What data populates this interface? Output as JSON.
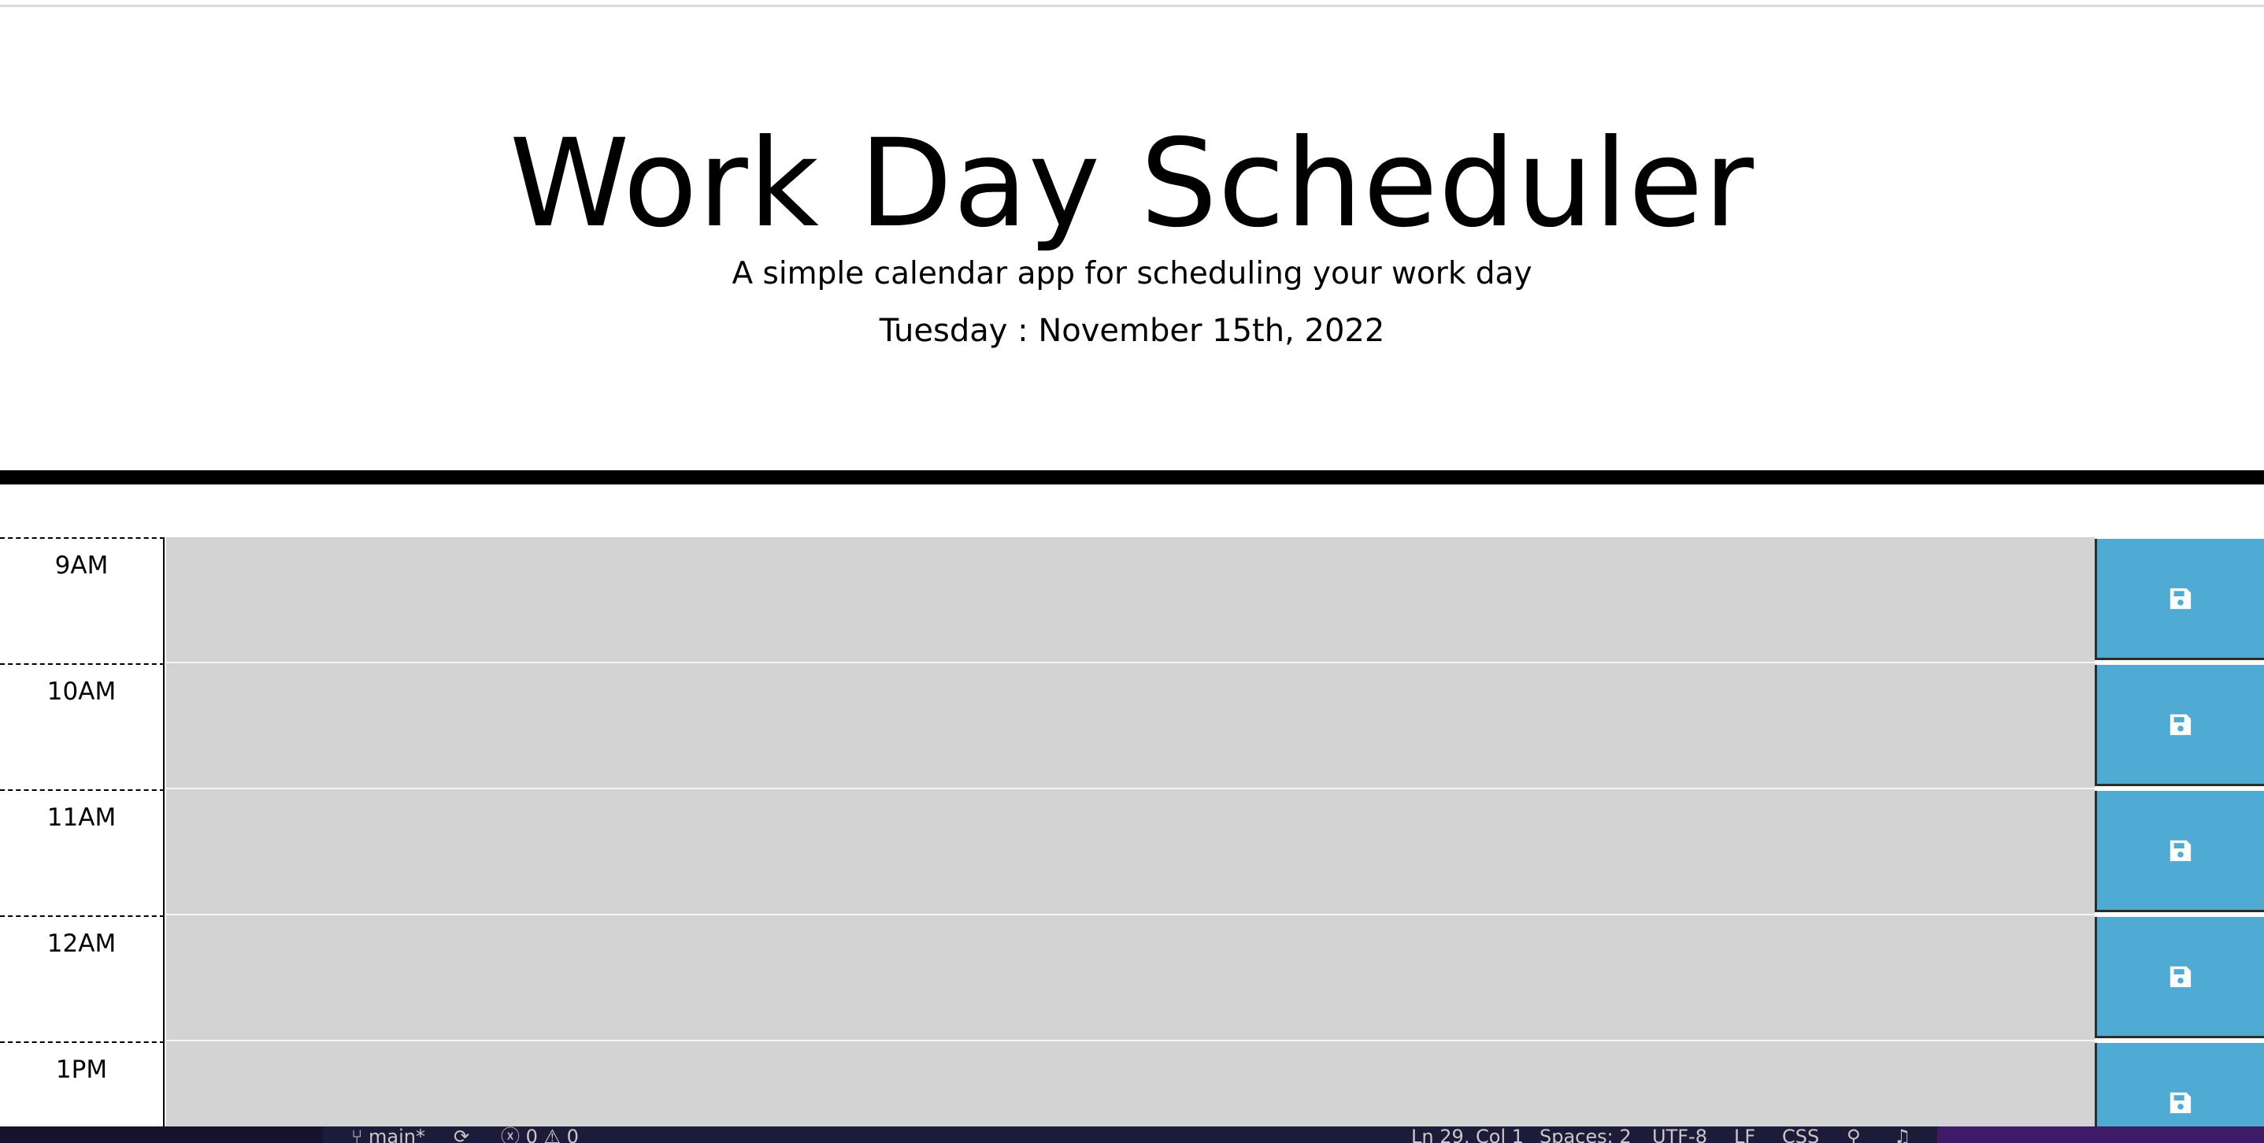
{
  "header": {
    "title": "Work Day Scheduler",
    "lead": "A simple calendar app for scheduling your work day",
    "current_day": "Tuesday : November 15th, 2022"
  },
  "schedule": {
    "rows": [
      {
        "hour": "9AM",
        "task": ""
      },
      {
        "hour": "10AM",
        "task": ""
      },
      {
        "hour": "11AM",
        "task": ""
      },
      {
        "hour": "12AM",
        "task": ""
      },
      {
        "hour": "1PM",
        "task": ""
      }
    ],
    "save_icon": "floppy-disk-icon"
  },
  "status_bar": {
    "branch": "main*",
    "problems": "ⓧ 0 ⚠ 0",
    "cursor": "Ln 29, Col 1",
    "spaces": "Spaces: 2",
    "encoding": "UTF-8",
    "eol": "LF",
    "language": "CSS"
  },
  "colors": {
    "past": "#d3d3d3",
    "save_button": "#4fabd3",
    "divider": "#000000"
  }
}
